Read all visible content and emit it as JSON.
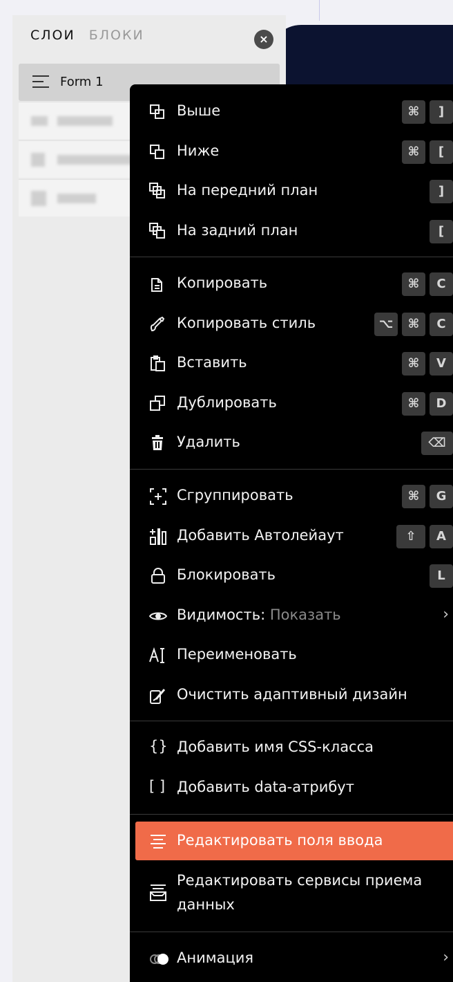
{
  "panel": {
    "tabs": [
      "СЛОИ",
      "БЛОКИ"
    ],
    "close_label": "×",
    "selected_layer": "Form 1"
  },
  "menu": {
    "items": [
      {
        "label": "Выше",
        "keys": [
          "⌘",
          "]"
        ],
        "icon": "bring-forward-icon"
      },
      {
        "label": "Ниже",
        "keys": [
          "⌘",
          "["
        ],
        "icon": "send-backward-icon"
      },
      {
        "label": "На передний план",
        "keys": [
          "]"
        ],
        "icon": "bring-to-front-icon"
      },
      {
        "label": "На задний план",
        "keys": [
          "["
        ],
        "icon": "send-to-back-icon"
      },
      {
        "label": "Копировать",
        "keys": [
          "⌘",
          "C"
        ],
        "icon": "copy-icon"
      },
      {
        "label": "Копировать стиль",
        "keys": [
          "⌥",
          "⌘",
          "C"
        ],
        "icon": "copy-style-icon"
      },
      {
        "label": "Вставить",
        "keys": [
          "⌘",
          "V"
        ],
        "icon": "paste-icon"
      },
      {
        "label": "Дублировать",
        "keys": [
          "⌘",
          "D"
        ],
        "icon": "duplicate-icon"
      },
      {
        "label": "Удалить",
        "keys": [
          "⌫"
        ],
        "icon": "trash-icon"
      },
      {
        "label": "Сгруппировать",
        "keys": [
          "⌘",
          "G"
        ],
        "icon": "group-icon"
      },
      {
        "label": "Добавить Автолейаут",
        "keys": [
          "⇧",
          "A"
        ],
        "icon": "autolayout-icon"
      },
      {
        "label": "Блокировать",
        "keys": [
          "L"
        ],
        "icon": "lock-icon"
      },
      {
        "label": "Видимость:",
        "value": "Показать",
        "icon": "eye-icon"
      },
      {
        "label": "Переименовать",
        "icon": "rename-icon"
      },
      {
        "label": "Очистить адаптивный дизайн",
        "icon": "clear-adaptive-icon"
      },
      {
        "label": "Добавить имя CSS-класса",
        "icon": "css-class-icon"
      },
      {
        "label": "Добавить data-атрибут",
        "icon": "data-attribute-icon"
      },
      {
        "label": "Редактировать поля ввода",
        "icon": "input-fields-icon"
      },
      {
        "label": "Редактировать сервисы приема",
        "label2": "данных",
        "icon": "data-services-icon"
      },
      {
        "label": "Анимация",
        "icon": "animation-icon"
      }
    ],
    "highlight_color": "#f06b49"
  }
}
